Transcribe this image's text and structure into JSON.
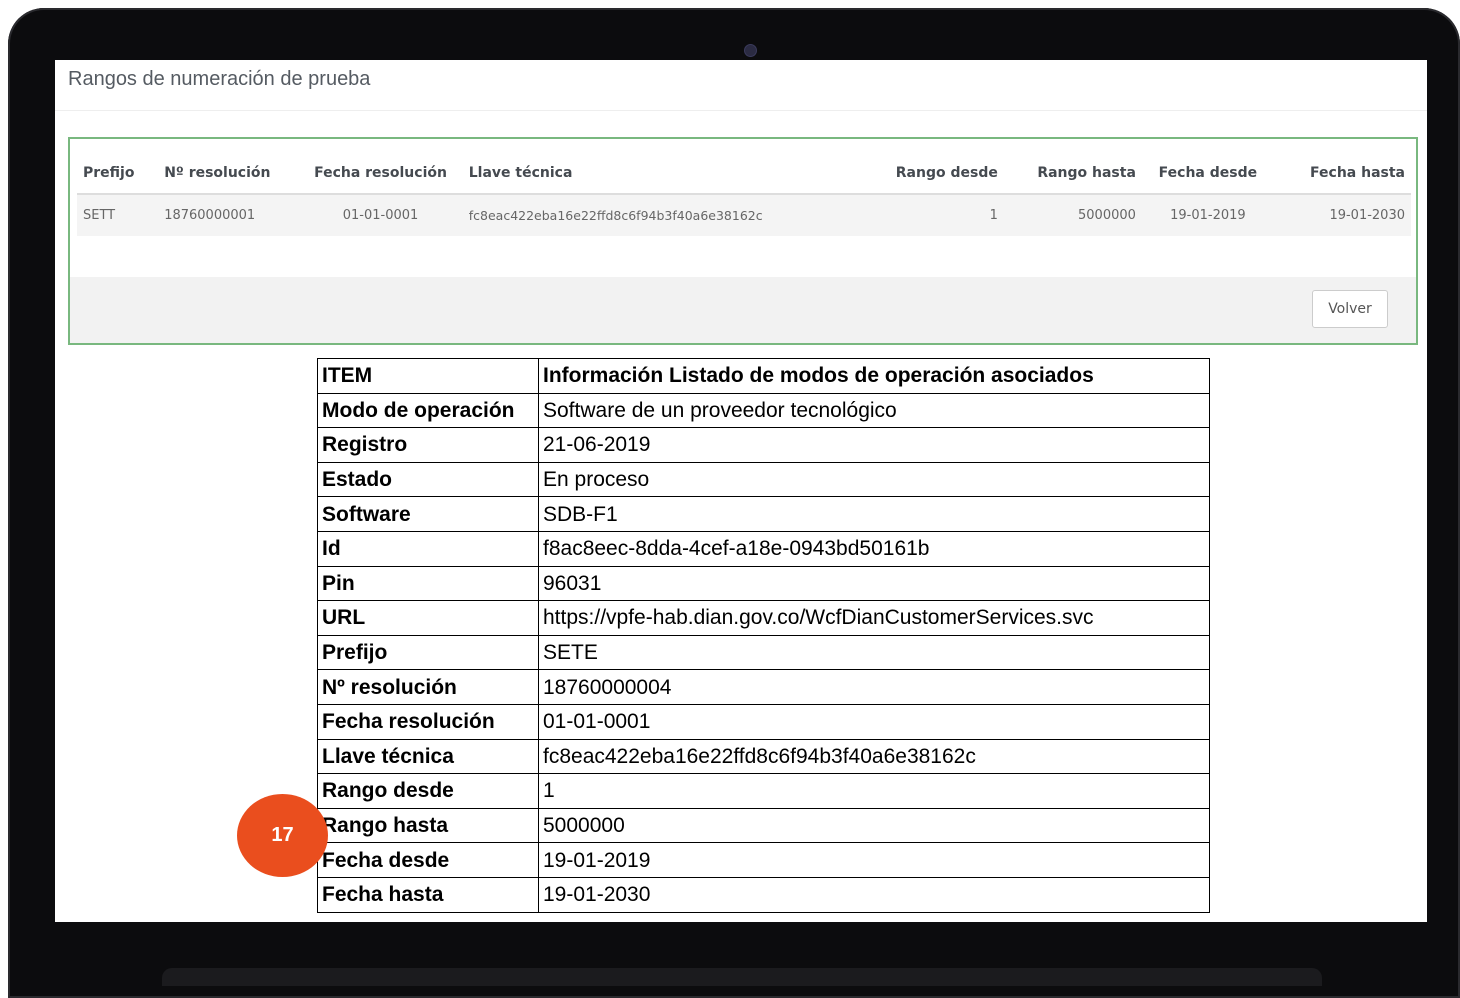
{
  "page_title": "Rangos de numeración de prueba",
  "ranges_table": {
    "headers": [
      "Prefijo",
      "Nº resolución",
      "Fecha resolución",
      "Llave técnica",
      "Rango desde",
      "Rango hasta",
      "Fecha desde",
      "Fecha hasta"
    ],
    "rows": [
      [
        "SETT",
        "18760000001",
        "01-01-0001",
        "fc8eac422eba16e22ffd8c6f94b3f40a6e38162c",
        "1",
        "5000000",
        "19-01-2019",
        "19-01-2030"
      ]
    ]
  },
  "back_button_label": "Volver",
  "info_table": {
    "header": [
      "ITEM",
      "Información Listado de modos de operación asociados"
    ],
    "rows": [
      [
        "Modo de operación",
        "Software de un proveedor tecnológico"
      ],
      [
        "Registro",
        "21-06-2019"
      ],
      [
        "Estado",
        "En proceso"
      ],
      [
        "Software",
        "SDB-F1"
      ],
      [
        "Id",
        "f8ac8eec-8dda-4cef-a18e-0943bd50161b"
      ],
      [
        "Pin",
        "96031"
      ],
      [
        "URL",
        "https://vpfe-hab.dian.gov.co/WcfDianCustomerServices.svc"
      ],
      [
        "Prefijo",
        "SETE"
      ],
      [
        "Nº resolución",
        "18760000004"
      ],
      [
        "Fecha resolución",
        "01-01-0001"
      ],
      [
        "Llave técnica",
        "fc8eac422eba16e22ffd8c6f94b3f40a6e38162c"
      ],
      [
        "Rango desde",
        "1"
      ],
      [
        "Rango hasta",
        "5000000"
      ],
      [
        "Fecha desde",
        "19-01-2019"
      ],
      [
        "Fecha hasta",
        "19-01-2030"
      ]
    ]
  },
  "page_badge": "17",
  "colors": {
    "panel_border": "#79b87f",
    "badge": "#ea4e1e",
    "laptop_frame": "#0c0c0e"
  }
}
